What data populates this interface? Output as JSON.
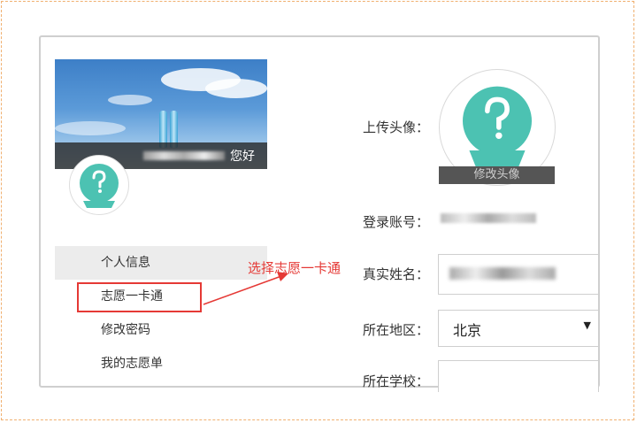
{
  "banner": {
    "greeting": "您好"
  },
  "menu": {
    "items": [
      {
        "label": "个人信息"
      },
      {
        "label": "志愿一卡通"
      },
      {
        "label": "修改密码"
      },
      {
        "label": "我的志愿单"
      }
    ]
  },
  "annotation": {
    "text": "选择志愿一卡通"
  },
  "form": {
    "avatar_label": "上传头像：",
    "edit_avatar": "修改头像",
    "account_label": "登录账号：",
    "name_label": "真实姓名：",
    "region_label": "所在地区：",
    "region_value": "北京",
    "school_label": "所在学校："
  },
  "colors": {
    "avatar": "#4cc2b2",
    "highlight": "#e53935",
    "active_menu_bg": "#ececec"
  }
}
